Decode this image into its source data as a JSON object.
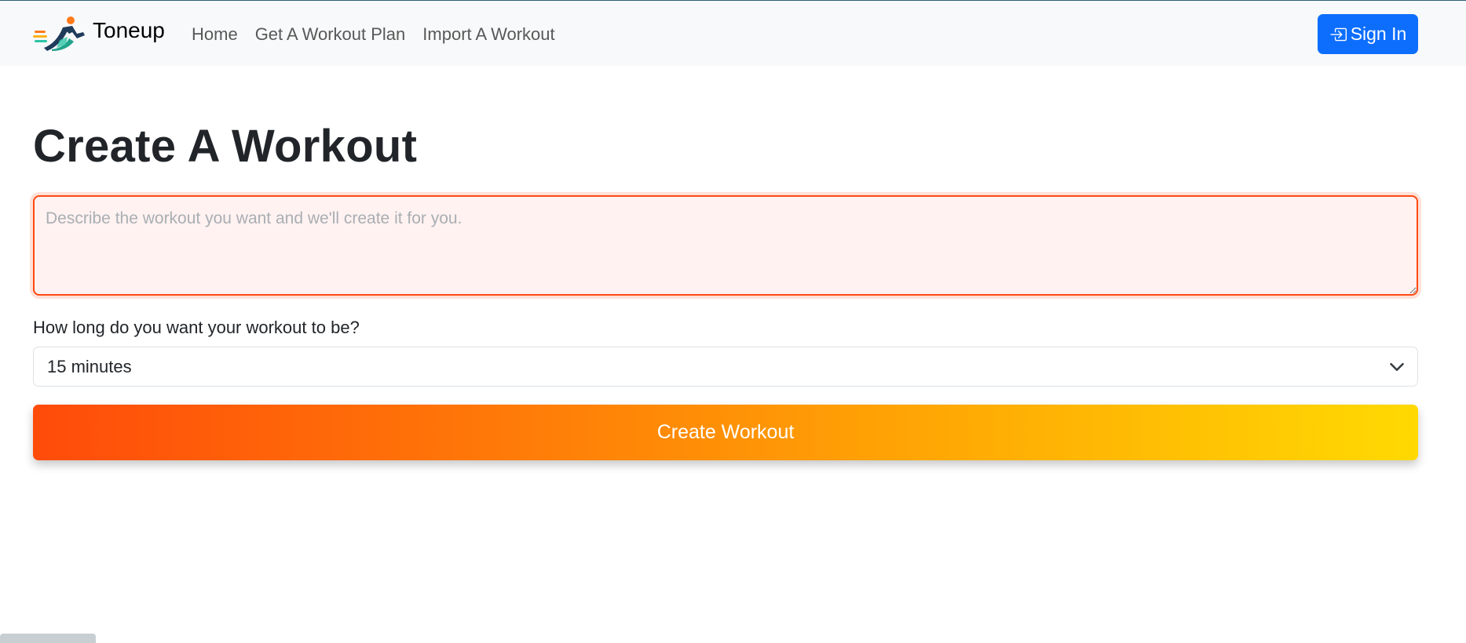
{
  "navbar": {
    "brand_name": "Toneup",
    "links": [
      "Home",
      "Get A Workout Plan",
      "Import A Workout"
    ],
    "sign_in_label": "Sign In"
  },
  "main": {
    "title": "Create A Workout",
    "description_placeholder": "Describe the workout you want and we'll create it for you.",
    "description_value": "",
    "duration_label": "How long do you want your workout to be?",
    "duration_selected": "15 minutes",
    "create_button_label": "Create Workout"
  },
  "colors": {
    "primary_blue": "#0d6efd",
    "gradient_start": "#ff4b0a",
    "gradient_end": "#ffd902",
    "textarea_border": "#ff4a12",
    "textarea_bg": "#fff2f1"
  },
  "icons": {
    "brand": "runner-logo-icon",
    "sign_in": "sign-in-icon",
    "select": "chevron-down-icon"
  }
}
